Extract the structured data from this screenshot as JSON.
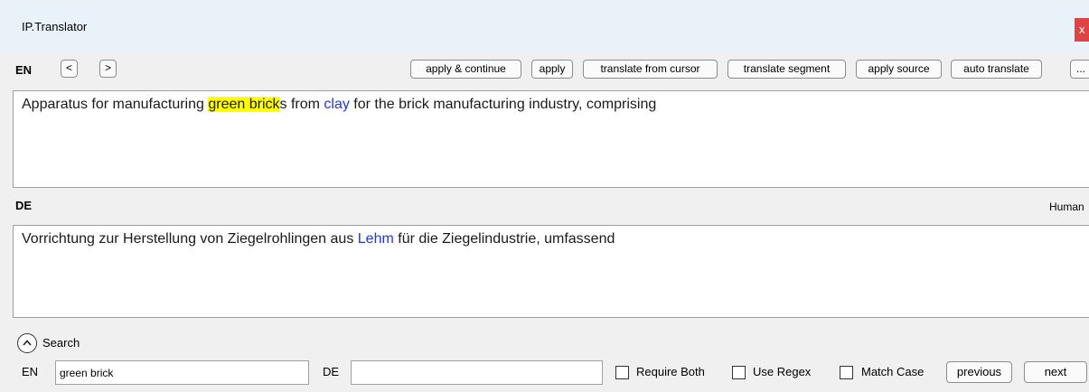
{
  "window": {
    "title": "IP.Translator",
    "close_label": "x"
  },
  "source": {
    "lang": "EN",
    "prev_label": "<",
    "next_label": ">",
    "text_before_highlight": "Apparatus for manufacturing ",
    "highlight": "green brick",
    "text_after_highlight": "s from ",
    "term": "clay",
    "text_end": " for the brick manufacturing industry, comprising"
  },
  "toolbar": {
    "apply_continue": "apply & continue",
    "apply": "apply",
    "translate_from_cursor": "translate from cursor",
    "translate_segment": "translate segment",
    "apply_source": "apply source",
    "auto_translate": "auto translate",
    "more": "..."
  },
  "target": {
    "lang": "DE",
    "status": "Human",
    "text_before_term": "Vorrichtung zur Herstellung von Ziegelrohlingen aus ",
    "term": "Lehm",
    "text_after_term": " für die Ziegelindustrie, umfassend"
  },
  "search": {
    "label": "Search",
    "en_label": "EN",
    "en_value": "green brick",
    "de_label": "DE",
    "de_value": "",
    "require_both": "Require Both",
    "use_regex": "Use Regex",
    "match_case": "Match Case",
    "previous": "previous",
    "next": "next"
  },
  "colors": {
    "highlight": "#ffff00",
    "term": "#1f37e0",
    "titlebar": "#eaf2f9",
    "panel": "#f0f0f0",
    "close": "#e04343"
  }
}
